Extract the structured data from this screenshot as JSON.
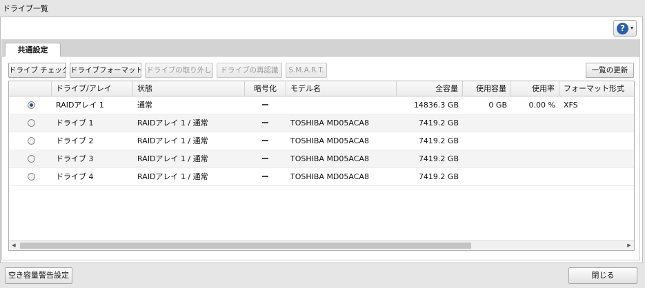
{
  "window": {
    "title": "ドライブ一覧"
  },
  "help": {
    "icon": "help-icon",
    "glyph": "?",
    "caret": "▾"
  },
  "tabs": [
    {
      "label": "共通設定"
    }
  ],
  "toolbar": {
    "drive_check": "ドライブ チェック",
    "drive_format": "ドライブフォーマット",
    "drive_remove": "ドライブの取り外し",
    "drive_reauth": "ドライブの再認識",
    "smart": "S.M.A.R.T.",
    "refresh": "一覧の更新"
  },
  "table": {
    "columns": [
      "",
      "ドライブ/アレイ",
      "状態",
      "暗号化",
      "モデル名",
      "全容量",
      "使用容量",
      "使用率",
      "フォーマット形式"
    ],
    "rows": [
      {
        "selected": true,
        "name": "RAIDアレイ 1",
        "status": "通常",
        "encryption": "—",
        "model": "",
        "capacity": "14836.3 GB",
        "used": "0 GB",
        "usage": "0.00 %",
        "format": "XFS"
      },
      {
        "selected": false,
        "name": "ドライブ 1",
        "status": "RAIDアレイ 1 / 通常",
        "encryption": "—",
        "model": "TOSHIBA MD05ACA8",
        "capacity": "7419.2 GB",
        "used": "",
        "usage": "",
        "format": ""
      },
      {
        "selected": false,
        "name": "ドライブ 2",
        "status": "RAIDアレイ 1 / 通常",
        "encryption": "—",
        "model": "TOSHIBA MD05ACA8",
        "capacity": "7419.2 GB",
        "used": "",
        "usage": "",
        "format": ""
      },
      {
        "selected": false,
        "name": "ドライブ 3",
        "status": "RAIDアレイ 1 / 通常",
        "encryption": "—",
        "model": "TOSHIBA MD05ACA8",
        "capacity": "7419.2 GB",
        "used": "",
        "usage": "",
        "format": ""
      },
      {
        "selected": false,
        "name": "ドライブ 4",
        "status": "RAIDアレイ 1 / 通常",
        "encryption": "—",
        "model": "TOSHIBA MD05ACA8",
        "capacity": "7419.2 GB",
        "used": "",
        "usage": "",
        "format": ""
      }
    ]
  },
  "scrollbar": {
    "left_arrow": "◀",
    "right_arrow": "▶"
  },
  "footer": {
    "space_warning": "空き容量警告設定",
    "close": "閉じる"
  },
  "colors": {
    "help_icon": "#2a5fa8",
    "radio_dot": "#2c4f88"
  }
}
